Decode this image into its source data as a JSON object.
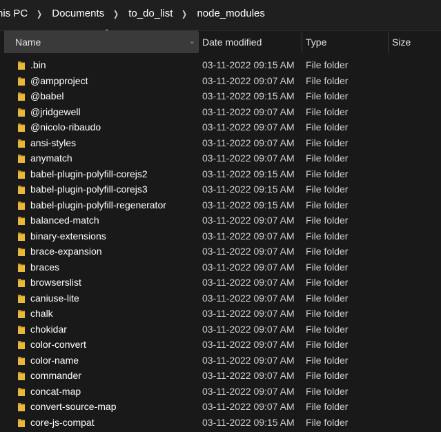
{
  "breadcrumb": [
    "his PC",
    "Documents",
    "to_do_list",
    "node_modules"
  ],
  "columns": {
    "name": "Name",
    "date": "Date modified",
    "type": "Type",
    "size": "Size"
  },
  "icons": {
    "folder": "folder-icon",
    "sort": "sort-up-icon",
    "dropdown": "chevron-down-icon",
    "separator": "chevron-right-icon"
  },
  "colors": {
    "folder": "#e8b838",
    "folder_dark": "#c9961e",
    "header_active": "#3a3a3a"
  },
  "rows": [
    {
      "name": ".bin",
      "date": "03-11-2022 09:15 AM",
      "type": "File folder"
    },
    {
      "name": "@ampproject",
      "date": "03-11-2022 09:07 AM",
      "type": "File folder"
    },
    {
      "name": "@babel",
      "date": "03-11-2022 09:15 AM",
      "type": "File folder"
    },
    {
      "name": "@jridgewell",
      "date": "03-11-2022 09:07 AM",
      "type": "File folder"
    },
    {
      "name": "@nicolo-ribaudo",
      "date": "03-11-2022 09:07 AM",
      "type": "File folder"
    },
    {
      "name": "ansi-styles",
      "date": "03-11-2022 09:07 AM",
      "type": "File folder"
    },
    {
      "name": "anymatch",
      "date": "03-11-2022 09:07 AM",
      "type": "File folder"
    },
    {
      "name": "babel-plugin-polyfill-corejs2",
      "date": "03-11-2022 09:15 AM",
      "type": "File folder"
    },
    {
      "name": "babel-plugin-polyfill-corejs3",
      "date": "03-11-2022 09:15 AM",
      "type": "File folder"
    },
    {
      "name": "babel-plugin-polyfill-regenerator",
      "date": "03-11-2022 09:15 AM",
      "type": "File folder"
    },
    {
      "name": "balanced-match",
      "date": "03-11-2022 09:07 AM",
      "type": "File folder"
    },
    {
      "name": "binary-extensions",
      "date": "03-11-2022 09:07 AM",
      "type": "File folder"
    },
    {
      "name": "brace-expansion",
      "date": "03-11-2022 09:07 AM",
      "type": "File folder"
    },
    {
      "name": "braces",
      "date": "03-11-2022 09:07 AM",
      "type": "File folder"
    },
    {
      "name": "browserslist",
      "date": "03-11-2022 09:07 AM",
      "type": "File folder"
    },
    {
      "name": "caniuse-lite",
      "date": "03-11-2022 09:07 AM",
      "type": "File folder"
    },
    {
      "name": "chalk",
      "date": "03-11-2022 09:07 AM",
      "type": "File folder"
    },
    {
      "name": "chokidar",
      "date": "03-11-2022 09:07 AM",
      "type": "File folder"
    },
    {
      "name": "color-convert",
      "date": "03-11-2022 09:07 AM",
      "type": "File folder"
    },
    {
      "name": "color-name",
      "date": "03-11-2022 09:07 AM",
      "type": "File folder"
    },
    {
      "name": "commander",
      "date": "03-11-2022 09:07 AM",
      "type": "File folder"
    },
    {
      "name": "concat-map",
      "date": "03-11-2022 09:07 AM",
      "type": "File folder"
    },
    {
      "name": "convert-source-map",
      "date": "03-11-2022 09:07 AM",
      "type": "File folder"
    },
    {
      "name": "core-js-compat",
      "date": "03-11-2022 09:15 AM",
      "type": "File folder"
    }
  ]
}
